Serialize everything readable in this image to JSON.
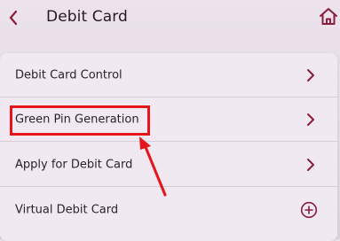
{
  "header": {
    "title": "Debit Card",
    "back_icon": "chevron-left-icon",
    "home_icon": "home-icon"
  },
  "menu": {
    "items": [
      {
        "label": "Debit Card Control",
        "icon": "chevron-right-icon"
      },
      {
        "label": "Green Pin Generation",
        "icon": "chevron-right-icon",
        "highlighted": true
      },
      {
        "label": "Apply for Debit Card",
        "icon": "chevron-right-icon"
      },
      {
        "label": "Virtual Debit Card",
        "icon": "plus-circle-icon"
      }
    ]
  },
  "colors": {
    "accent": "#8a1c3c",
    "highlight": "#e8141b",
    "background": "#ece3ec",
    "card": "#f0e9f1"
  }
}
